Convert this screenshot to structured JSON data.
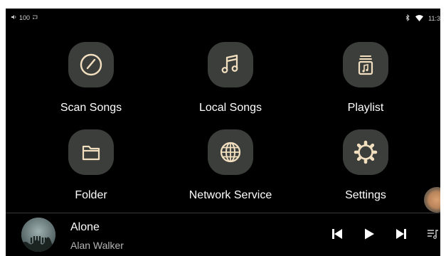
{
  "status_bar": {
    "volume_text": "100",
    "time": "11:3"
  },
  "tiles": [
    {
      "label": "Scan Songs",
      "icon": "scan-icon"
    },
    {
      "label": "Local Songs",
      "icon": "music-note-icon"
    },
    {
      "label": "Playlist",
      "icon": "playlist-icon"
    },
    {
      "label": "Folder",
      "icon": "folder-icon"
    },
    {
      "label": "Network Service",
      "icon": "globe-icon"
    },
    {
      "label": "Settings",
      "icon": "gear-icon"
    }
  ],
  "now_playing": {
    "title": "Alone",
    "artist": "Alan Walker"
  },
  "colors": {
    "background": "#000000",
    "tile_bg": "#3b3e3b",
    "icon_stroke": "#f2dfc0",
    "floating_button": "#c58d61"
  }
}
